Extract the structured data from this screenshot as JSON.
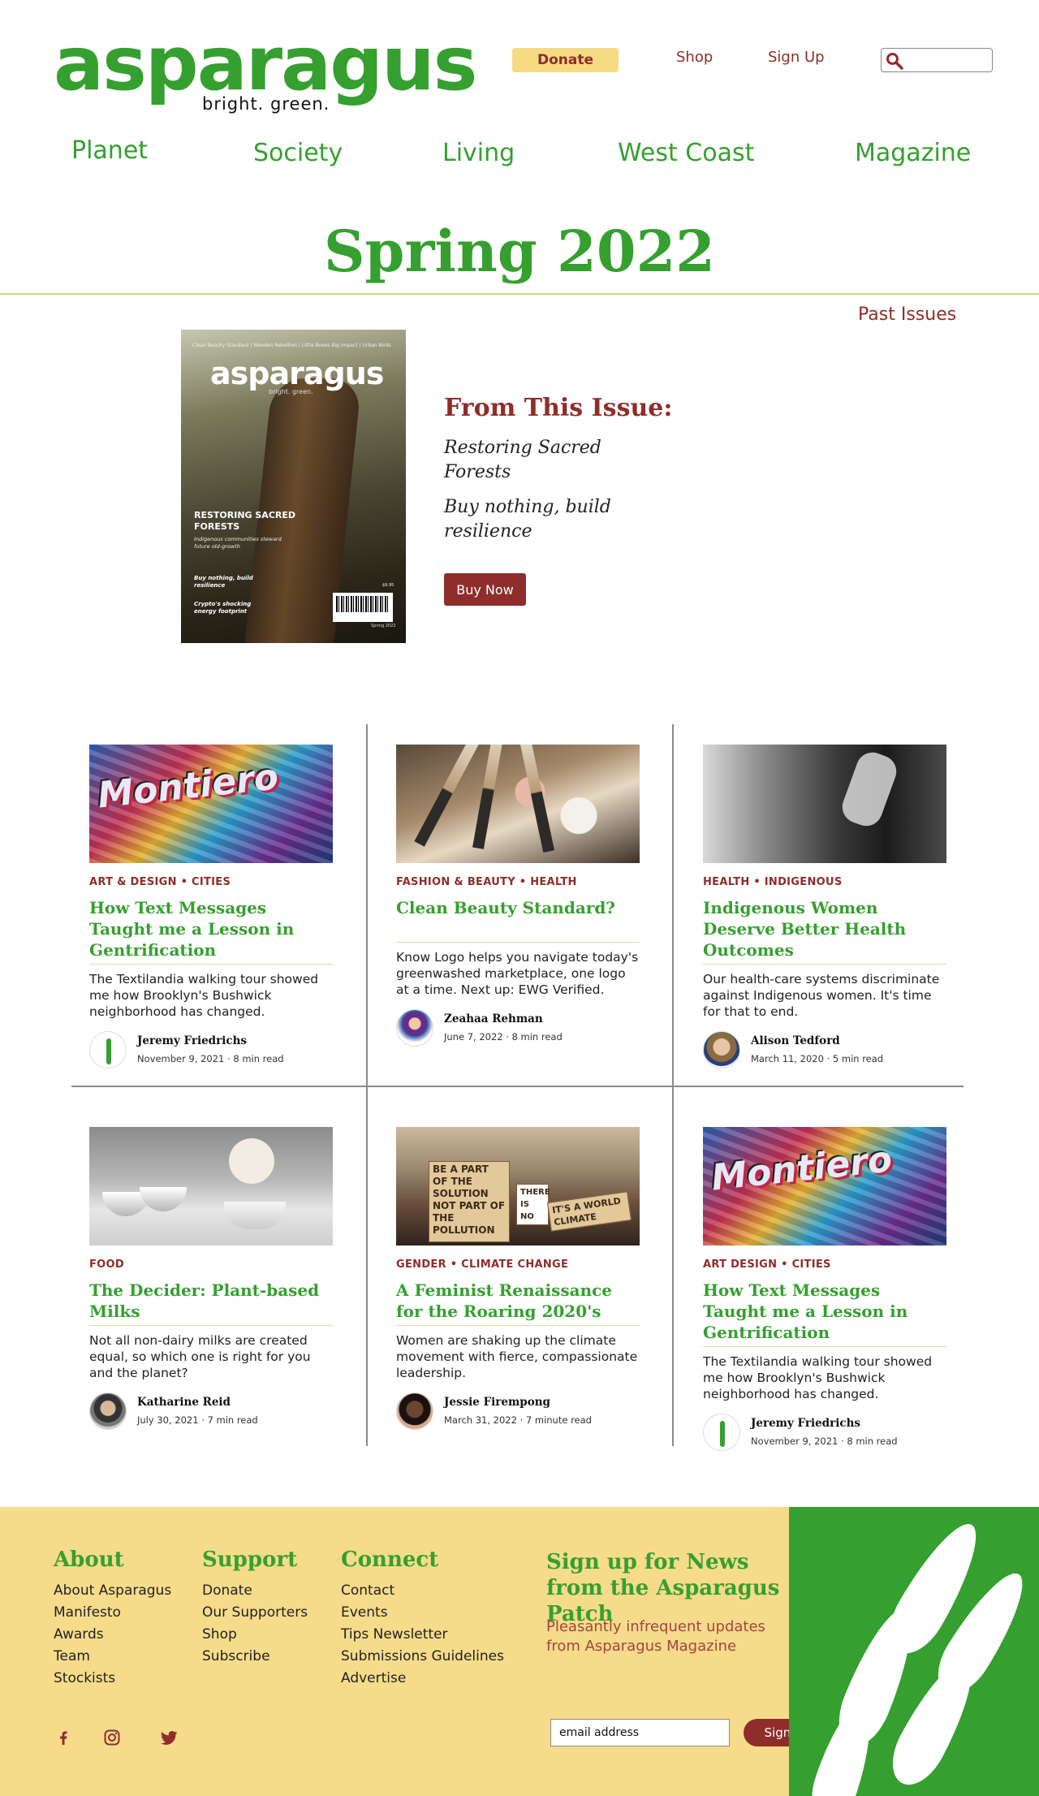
{
  "header": {
    "logo_word": "asparagus",
    "logo_tagline": "bright. green.",
    "donate_label": "Donate",
    "shop_label": "Shop",
    "signup_label": "Sign Up",
    "search_placeholder": "",
    "search_icon": "search-icon"
  },
  "nav": {
    "items": [
      "Planet",
      "Society",
      "Living",
      "West Coast",
      "Magazine"
    ]
  },
  "issue": {
    "title": "Spring 2022",
    "past_issues": "Past Issues",
    "cover": {
      "top_line": "Clean Beauty Standard | Wooden Rebellion | Little Boxes Big Impact | Urban Birds",
      "logo": "asparagus",
      "tagline": "bright. green.",
      "headline": "RESTORING SACRED FORESTS",
      "subhead": "Indigenous communities steward future old-growth",
      "note1": "Buy nothing, build resilience",
      "note2": "Crypto's shocking energy footprint",
      "price": "$9.95",
      "date": "Spring 2022"
    },
    "from_title": "From This Issue:",
    "from_items": [
      "Restoring Sacred Forests",
      "Buy nothing, build resilience"
    ],
    "buy_label": "Buy Now"
  },
  "articles": [
    {
      "categories": "ART & DESIGN • CITIES",
      "title": "How Text Messages Taught me a Lesson in Gentrification",
      "excerpt": "The Textilandia walking tour showed me how Brooklyn's Bushwick neighborhood has changed.",
      "author": "Jeremy Friedrichs",
      "meta": "November 9, 2021 · 8 min read",
      "mural_text": "Montiero"
    },
    {
      "categories": "FASHION & BEAUTY • HEALTH",
      "title": "Clean Beauty Standard?",
      "excerpt": "Know Logo helps you navigate today's greenwashed marketplace, one logo at a time. Next up: EWG Verified.",
      "author": "Zeahaa Rehman",
      "meta": "June 7, 2022 · 8 min read"
    },
    {
      "categories": "HEALTH • INDIGENOUS",
      "title": "Indigenous Women Deserve Better Health Outcomes",
      "excerpt": "Our health-care systems discriminate against Indigenous women. It's time for that to end.",
      "author": "Alison Tedford",
      "meta": "March 11, 2020 · 5 min read"
    },
    {
      "categories": "FOOD",
      "title": "The Decider: Plant-based Milks",
      "excerpt": "Not all non-dairy milks are created equal, so which one is right for you and the planet?",
      "author": "Katharine Reid",
      "meta": "July 30, 2021 · 7 min read"
    },
    {
      "categories": "GENDER • CLIMATE CHANGE",
      "title": "A Feminist Renaissance for the Roaring 2020's",
      "excerpt": "Women are shaking up the climate movement with fierce, compassionate leadership.",
      "author": "Jessie Firempong",
      "meta": "March 31, 2022 · 7 minute read",
      "signs": [
        "BE A PART OF THE SOLUTION NOT PART OF THE POLLUTION",
        "THERE IS NO",
        "IT'S A WORLD CLIMATE"
      ]
    },
    {
      "categories": "ART DESIGN • CITIES",
      "title": "How Text Messages Taught me a Lesson in Gentrification",
      "excerpt": "The Textilandia walking tour showed me how Brooklyn's Bushwick neighborhood has changed.",
      "author": "Jeremy Friedrichs",
      "meta": "November 9, 2021 · 8 min read",
      "mural_text": "Montiero"
    }
  ],
  "footer": {
    "about": {
      "heading": "About",
      "links": [
        "About Asparagus",
        "Manifesto",
        "Awards",
        "Team",
        "Stockists"
      ]
    },
    "support": {
      "heading": "Support",
      "links": [
        "Donate",
        "Our Supporters",
        "Shop",
        "Subscribe"
      ]
    },
    "connect": {
      "heading": "Connect",
      "links": [
        "Contact",
        "Events",
        "Tips Newsletter",
        "Submissions Guidelines",
        "Advertise"
      ]
    },
    "signup_title": "Sign up for News from the Asparagus Patch",
    "signup_sub": "Pleasantly infrequent updates from Asparagus Magazine",
    "email_placeholder": "email address",
    "signup_button": "Sign Up",
    "social_icons": [
      "facebook-icon",
      "instagram-icon",
      "twitter-icon"
    ]
  },
  "colors": {
    "brand_green": "#35a02f",
    "maroon": "#8f2d2a",
    "footer_yellow": "#f6db8b",
    "donate_yellow": "#f6db82"
  }
}
